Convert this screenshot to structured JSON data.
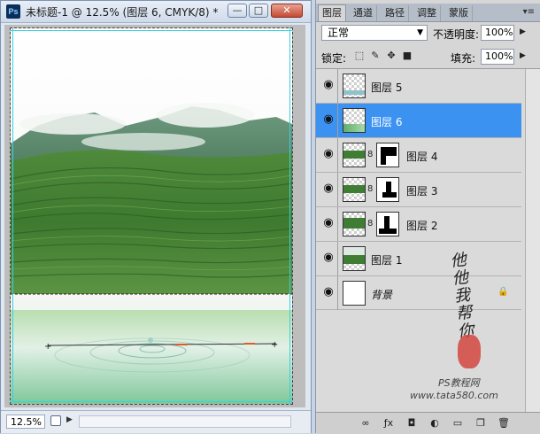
{
  "document": {
    "title": "未标题-1 @ 12.5% (图层 6, CMYK/8) *",
    "app_badge": "Ps",
    "zoom": "12.5%",
    "window_buttons": {
      "minimize": "—",
      "maximize": "□",
      "close": "✕"
    }
  },
  "layers_panel": {
    "tabs": [
      {
        "label": "图层",
        "active": true
      },
      {
        "label": "通道",
        "active": false
      },
      {
        "label": "路径",
        "active": false
      },
      {
        "label": "调整",
        "active": false
      },
      {
        "label": "蒙版",
        "active": false
      }
    ],
    "menu_icon": "panel-menu-icon",
    "blend_mode": "正常",
    "opacity_label": "不透明度:",
    "opacity_value": "100%",
    "lock_label": "锁定:",
    "fill_label": "填充:",
    "fill_value": "100%",
    "layers": [
      {
        "name": "图层 5",
        "visible": true,
        "selected": false,
        "has_mask": false,
        "thumb": "water-strip"
      },
      {
        "name": "图层 6",
        "visible": true,
        "selected": true,
        "has_mask": false,
        "thumb": "green-gradient"
      },
      {
        "name": "图层 4",
        "visible": true,
        "selected": false,
        "has_mask": true,
        "thumb": "tea-field"
      },
      {
        "name": "图层 3",
        "visible": true,
        "selected": false,
        "has_mask": true,
        "thumb": "tea-field"
      },
      {
        "name": "图层 2",
        "visible": true,
        "selected": false,
        "has_mask": true,
        "thumb": "tea-field"
      },
      {
        "name": "图层 1",
        "visible": true,
        "selected": false,
        "has_mask": false,
        "thumb": "tea-field"
      },
      {
        "name": "背景",
        "visible": true,
        "selected": false,
        "has_mask": false,
        "thumb": "white",
        "locked": true
      }
    ],
    "footer_icons": [
      "link-icon",
      "fx-icon",
      "mask-icon",
      "adjustment-icon",
      "group-icon",
      "new-layer-icon",
      "trash-icon"
    ]
  },
  "watermark": {
    "signature_text": "他他我帮你",
    "site_text": "PS教程网",
    "url_text": "www.tata580.com"
  },
  "colors": {
    "selection_blue": "#3c92f1",
    "guide_cyan": "#37d3e0",
    "tea_green": "#3f7d34"
  }
}
